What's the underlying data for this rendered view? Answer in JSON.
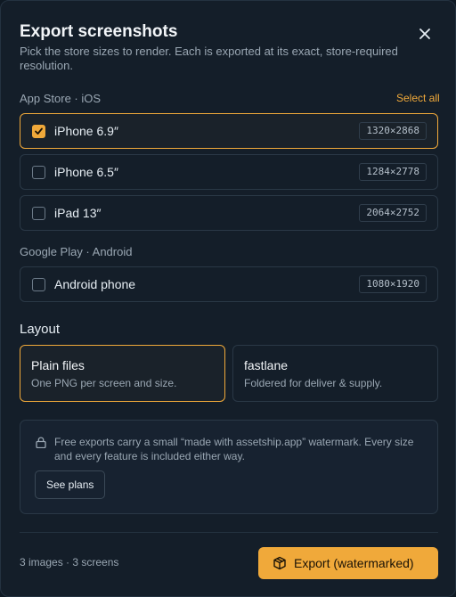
{
  "dialog": {
    "title": "Export screenshots",
    "subtitle": "Pick the store sizes to render. Each is exported at its exact, store-required resolution."
  },
  "app_store": {
    "label": "App Store · iOS",
    "select_all": "Select all",
    "sizes": [
      {
        "label": "iPhone 6.9″",
        "resolution": "1320×2868",
        "checked": true
      },
      {
        "label": "iPhone 6.5″",
        "resolution": "1284×2778",
        "checked": false
      },
      {
        "label": "iPad 13″",
        "resolution": "2064×2752",
        "checked": false
      }
    ]
  },
  "google_play": {
    "label": "Google Play · Android",
    "sizes": [
      {
        "label": "Android phone",
        "resolution": "1080×1920",
        "checked": false
      }
    ]
  },
  "layout": {
    "label": "Layout",
    "options": [
      {
        "title": "Plain files",
        "description": "One PNG per screen and size.",
        "selected": true
      },
      {
        "title": "fastlane",
        "description": "Foldered for deliver & supply.",
        "selected": false
      }
    ]
  },
  "notice": {
    "text": "Free exports carry a small “made with assetship.app” watermark. Every size and every feature is included either way.",
    "button": "See plans",
    "icon": "lock-icon"
  },
  "footer": {
    "status": "3 images · 3 screens",
    "export_label": "Export (watermarked)",
    "export_icon": "package-icon"
  },
  "colors": {
    "accent": "#f0a93a",
    "background": "#141e29",
    "border": "#2a3846"
  }
}
